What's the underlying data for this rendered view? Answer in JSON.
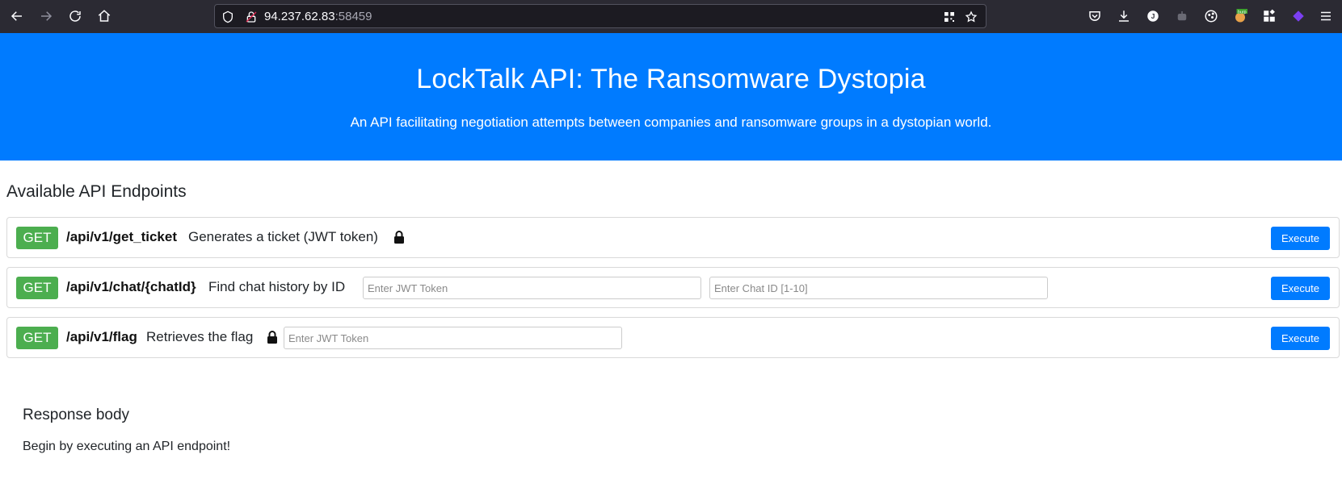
{
  "browser": {
    "url_host": "94.237.62.83",
    "url_port": ":58459",
    "profile_initial": "J",
    "burp_badge": "burp"
  },
  "page": {
    "title": "LockTalk API: The Ransomware Dystopia",
    "subtitle": "An API facilitating negotiation attempts between companies and ransomware groups in a dystopian world.",
    "endpoints_heading": "Available API Endpoints",
    "endpoints": [
      {
        "method": "GET",
        "path": "/api/v1/get_ticket",
        "description": "Generates a ticket (JWT token)",
        "execute_label": "Execute"
      },
      {
        "method": "GET",
        "path": "/api/v1/chat/{chatId}",
        "description": "Find chat history by ID",
        "token_placeholder": "Enter JWT Token",
        "chat_placeholder": "Enter Chat ID [1-10]",
        "execute_label": "Execute"
      },
      {
        "method": "GET",
        "path": "/api/v1/flag",
        "description": "Retrieves the flag",
        "token_placeholder": "Enter JWT Token",
        "execute_label": "Execute"
      }
    ],
    "response_heading": "Response body",
    "response_text": "Begin by executing an API endpoint!"
  },
  "colors": {
    "hero_bg": "#007bff",
    "method_badge": "#4cae4f",
    "execute_button": "#007bff",
    "browser_toolbar": "#2b2a33"
  }
}
